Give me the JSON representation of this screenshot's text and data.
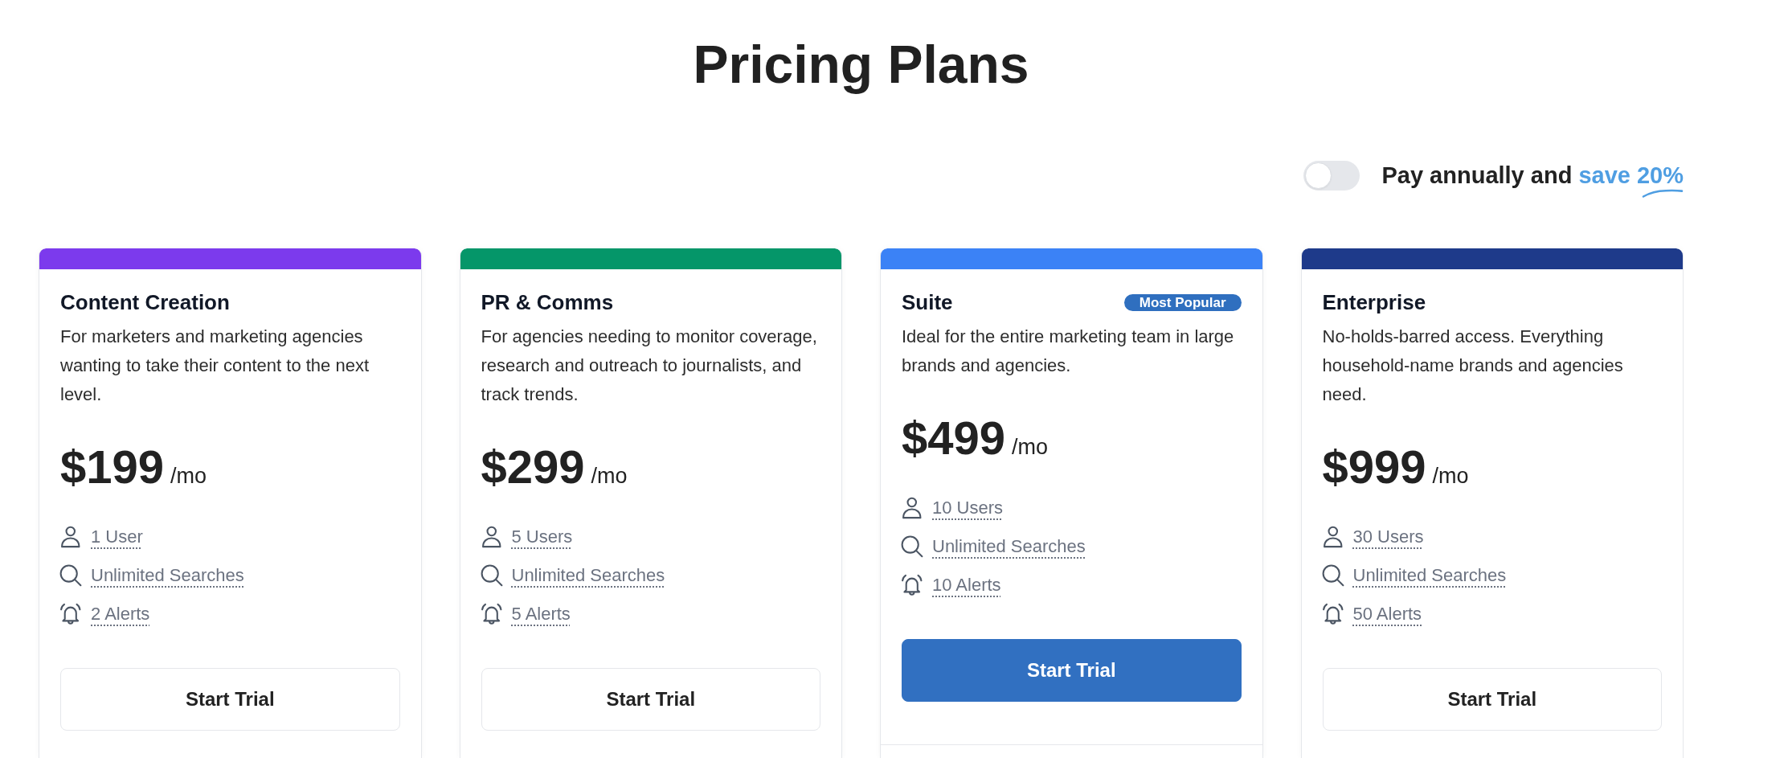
{
  "title": "Pricing Plans",
  "billing": {
    "on": false,
    "label": "Pay annually and",
    "highlight": "save 20%"
  },
  "plans": [
    {
      "name": "Content Creation",
      "color": "#7c3aed",
      "featured": false,
      "description": "For marketers and marketing agencies wanting to take their content to the next level.",
      "price": "$199",
      "period": "/mo",
      "features": [
        {
          "kind": "users",
          "text": "1 User"
        },
        {
          "kind": "searches",
          "text": "Unlimited Searches"
        },
        {
          "kind": "alerts",
          "text": "2 Alerts"
        }
      ],
      "button": "Start Trial"
    },
    {
      "name": "PR & Comms",
      "color": "#059669",
      "featured": false,
      "description": "For agencies needing to monitor coverage, research and outreach to journalists, and track trends.",
      "price": "$299",
      "period": "/mo",
      "features": [
        {
          "kind": "users",
          "text": "5 Users"
        },
        {
          "kind": "searches",
          "text": "Unlimited Searches"
        },
        {
          "kind": "alerts",
          "text": "5 Alerts"
        }
      ],
      "button": "Start Trial"
    },
    {
      "name": "Suite",
      "badge": "Most Popular",
      "color": "#3b82f6",
      "featured": true,
      "description": "Ideal for the entire marketing team in large brands and agencies.",
      "price": "$499",
      "period": "/mo",
      "features": [
        {
          "kind": "users",
          "text": "10 Users"
        },
        {
          "kind": "searches",
          "text": "Unlimited Searches"
        },
        {
          "kind": "alerts",
          "text": "10 Alerts"
        }
      ],
      "button": "Start Trial"
    },
    {
      "name": "Enterprise",
      "color": "#1e3a8a",
      "featured": false,
      "description": "No-holds-barred access. Everything household-name brands and agencies need.",
      "price": "$999",
      "period": "/mo",
      "features": [
        {
          "kind": "users",
          "text": "30 Users"
        },
        {
          "kind": "searches",
          "text": "Unlimited Searches"
        },
        {
          "kind": "alerts",
          "text": "50 Alerts"
        }
      ],
      "button": "Start Trial"
    }
  ]
}
